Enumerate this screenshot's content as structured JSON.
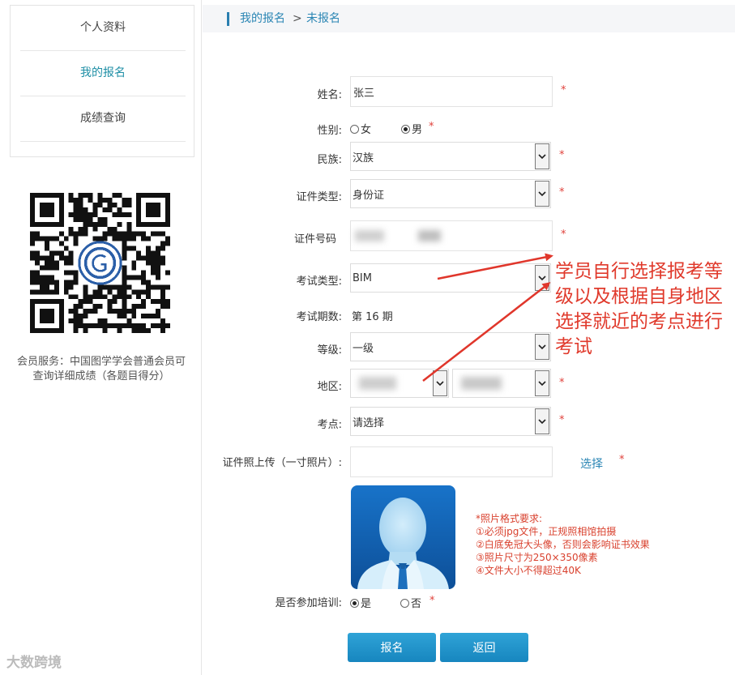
{
  "sidebar": {
    "items": [
      {
        "label": "个人资料"
      },
      {
        "label": "我的报名"
      },
      {
        "label": "成绩查询"
      }
    ],
    "qr_caption": "会员服务：中国图学学会普通会员可查询详细成绩（各题目得分）"
  },
  "breadcrumb": {
    "root": "我的报名",
    "sep": ">",
    "current": "未报名"
  },
  "form": {
    "name": {
      "label": "姓名:",
      "value": "张三"
    },
    "gender": {
      "label": "性别:",
      "opt_female": "女",
      "opt_male": "男",
      "selected": "男"
    },
    "ethnicity": {
      "label": "民族:",
      "value": "汉族"
    },
    "id_type": {
      "label": "证件类型:",
      "value": "身份证"
    },
    "id_number": {
      "label": "证件号码"
    },
    "exam_type": {
      "label": "考试类型:",
      "value": "BIM"
    },
    "exam_period": {
      "label": "考试期数:",
      "value": "第 16 期"
    },
    "level": {
      "label": "等级:",
      "value": "一级"
    },
    "region": {
      "label": "地区:"
    },
    "exam_site": {
      "label": "考点:",
      "value": "请选择"
    },
    "photo": {
      "label": "证件照上传（一寸照片）:",
      "choose": "选择"
    },
    "training": {
      "label": "是否参加培训:",
      "opt_yes": "是",
      "opt_no": "否",
      "selected": "是"
    },
    "required_mark": "*"
  },
  "photo_requirements": {
    "title": "*照片格式要求:",
    "lines": [
      "①必须jpg文件，正规照相馆拍摄",
      "②白底免冠大头像，否则会影响证书效果",
      "③照片尺寸为250×350像素",
      "④文件大小不得超过40K"
    ]
  },
  "annotation": "学员自行选择报考等级以及根据自身地区选择就近的考点进行考试",
  "buttons": {
    "submit": "报名",
    "back": "返回"
  },
  "watermark": "大数跨境",
  "colors": {
    "accent": "#1f8fa6",
    "button": "#1e90c8",
    "required": "#e0413b",
    "annotation": "#e03a2c"
  }
}
